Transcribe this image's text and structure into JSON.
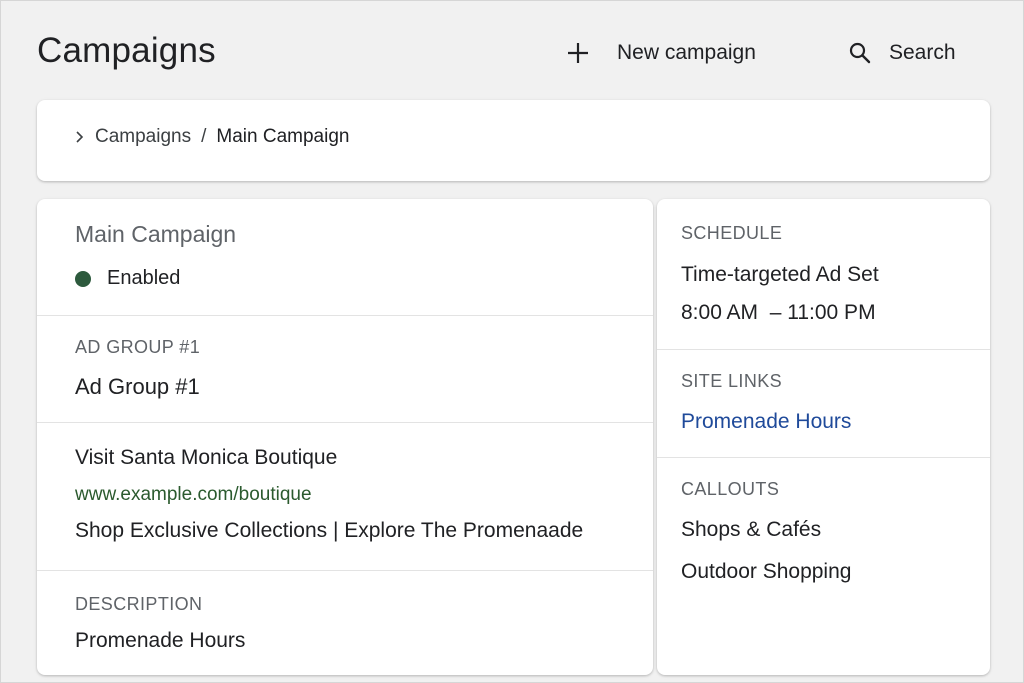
{
  "header": {
    "title": "Campaigns",
    "new_campaign_label": "New campaign",
    "search_label": "Search"
  },
  "breadcrumb": {
    "parent": "Campaigns",
    "separator": "/",
    "current": "Main Campaign"
  },
  "campaign": {
    "name": "Main Campaign",
    "status": "Enabled",
    "status_color": "#2d5a3d"
  },
  "ad_group": {
    "label": "AD GROUP #1",
    "name": "Ad Group #1"
  },
  "ad": {
    "headline": "Visit Santa Monica Boutique",
    "display_url": "www.example.com/boutique",
    "headline_2": "Shop Exclusive Collections | Explore The Promenaade"
  },
  "description": {
    "label": "DESCRIPTION",
    "value": "Promenade Hours"
  },
  "schedule": {
    "label": "SCHEDULE",
    "name": "Time-targeted Ad Set",
    "time_range": "8:00 AM  – 11:00 PM"
  },
  "site_links": {
    "label": "SITE LINKS",
    "items": [
      "Promenade Hours"
    ]
  },
  "callouts": {
    "label": "CALLOUTS",
    "items": [
      "Shops & Cafés",
      "Outdoor Shopping"
    ]
  },
  "colors": {
    "link_blue": "#1f4a9a",
    "url_green": "#2b5a2e",
    "status_green": "#2d5a3d"
  },
  "icons": {
    "new_campaign": "plus-icon",
    "search": "search-icon",
    "breadcrumb": "chevron-right-icon"
  }
}
